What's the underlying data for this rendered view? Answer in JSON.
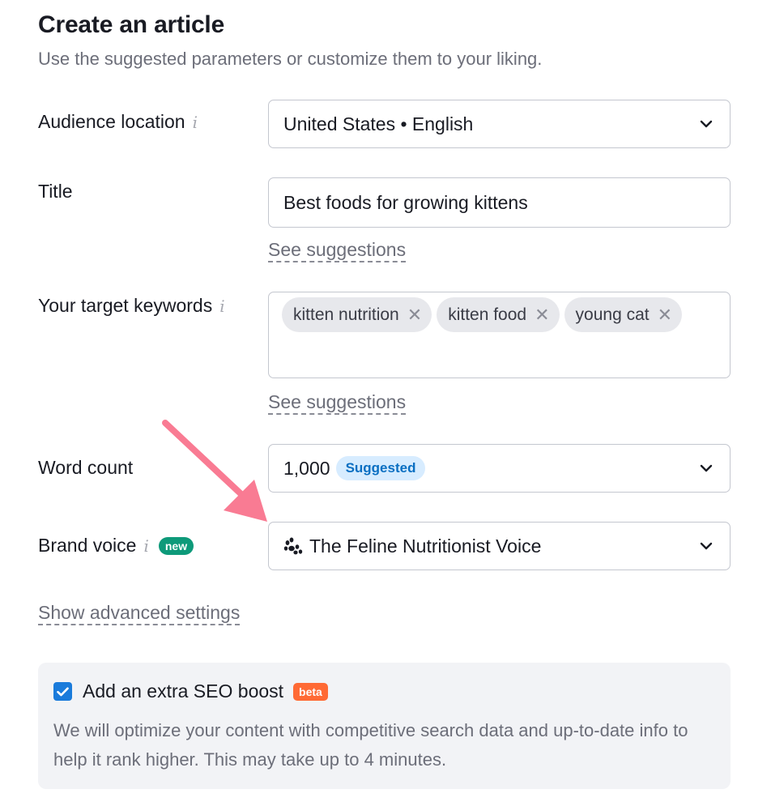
{
  "header": {
    "title": "Create an article",
    "subtitle": "Use the suggested parameters or customize them to your liking."
  },
  "info_icon_glyph": "i",
  "audience_location": {
    "label": "Audience location",
    "value": "United States • English"
  },
  "title_field": {
    "label": "Title",
    "value": "Best foods for growing kittens",
    "suggestions_link": "See suggestions"
  },
  "keywords": {
    "label": "Your target keywords",
    "chips": [
      "kitten nutrition",
      "kitten food",
      "young cat"
    ],
    "remove_glyph": "✕",
    "suggestions_link": "See suggestions"
  },
  "word_count": {
    "label": "Word count",
    "value": "1,000",
    "badge": "Suggested"
  },
  "brand_voice": {
    "label": "Brand voice",
    "badge": "new",
    "icon": "paw-icon",
    "value": "The Feline Nutritionist Voice"
  },
  "advanced_link": "Show advanced settings",
  "seo_boost": {
    "checked": true,
    "title": "Add an extra SEO boost",
    "badge": "beta",
    "description": "We will optimize your content with competitive search data and up-to-date info to help it rank higher. This may take up to 4 minutes."
  },
  "colors": {
    "accent_blue": "#1a7bdb",
    "new_badge": "#0e9a7a",
    "beta_badge": "#ff6a35",
    "annotation_arrow": "#f97b93"
  }
}
